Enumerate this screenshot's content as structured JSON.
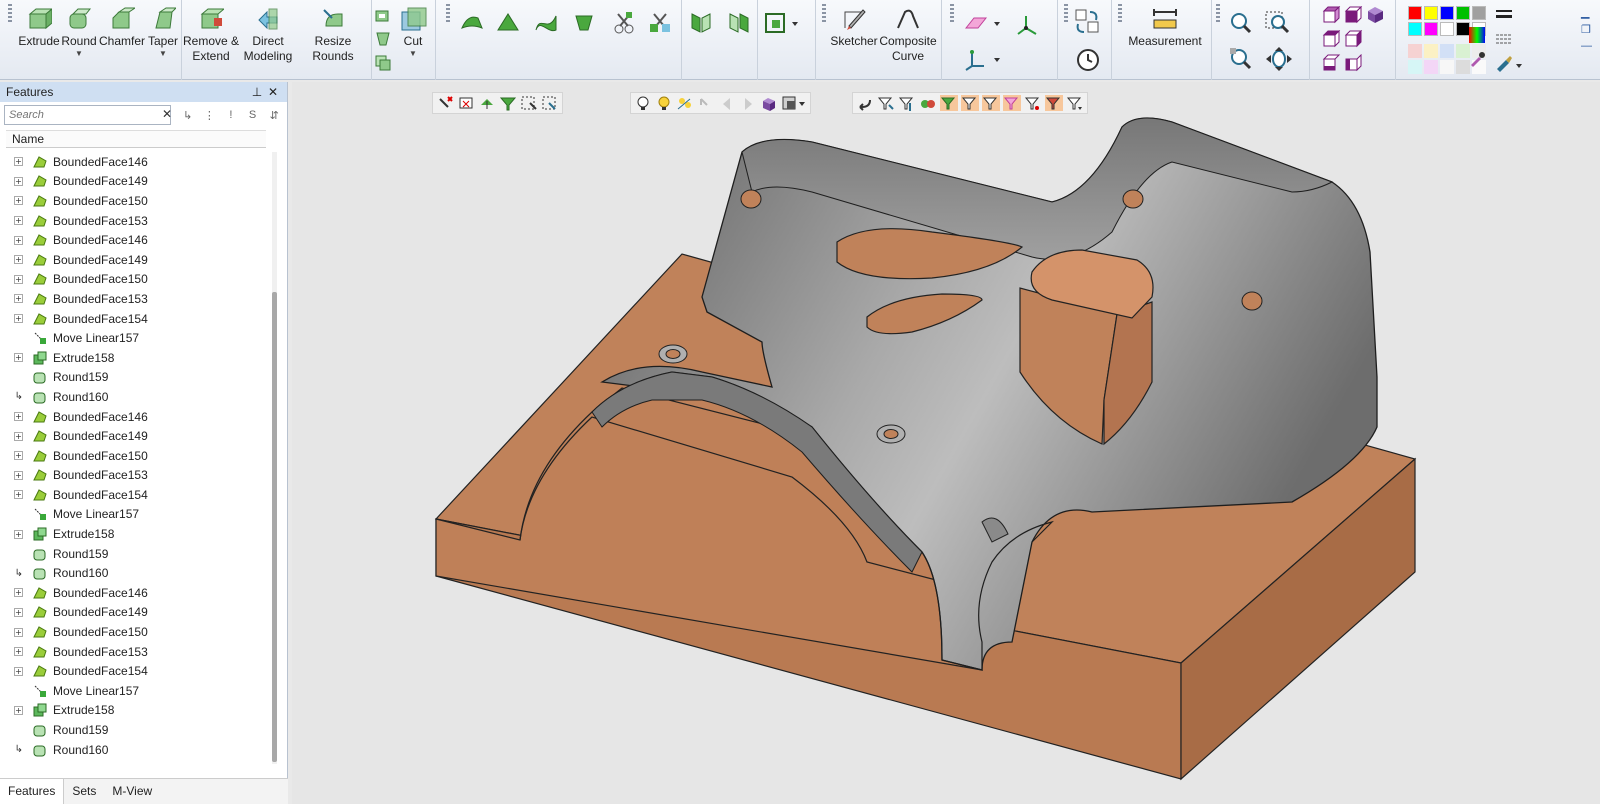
{
  "ribbon": {
    "extrude": "Extrude",
    "round": "Round",
    "chamfer": "Chamfer",
    "taper": "Taper",
    "remove_extend": [
      "Remove &",
      "Extend"
    ],
    "direct_modeling": [
      "Direct",
      "Modeling"
    ],
    "resize_rounds": "Resize Rounds",
    "cut": "Cut",
    "sketcher": "Sketcher",
    "composite_curve": [
      "Composite",
      "Curve"
    ],
    "measurement": "Measurement",
    "palette": [
      "#ff0000",
      "#ffff00",
      "#0000ff",
      "#00c000",
      "#a0a0a0",
      "#00ffff",
      "#ff00ff",
      "#ffffff",
      "#000000",
      "#ffffff"
    ]
  },
  "panel": {
    "title": "Features",
    "search_placeholder": "Search",
    "column": "Name",
    "tree": [
      {
        "label": "BoundedFace146",
        "kind": "face"
      },
      {
        "label": "BoundedFace149",
        "kind": "face"
      },
      {
        "label": "BoundedFace150",
        "kind": "face"
      },
      {
        "label": "BoundedFace153",
        "kind": "face"
      },
      {
        "label": "BoundedFace146",
        "kind": "face"
      },
      {
        "label": "BoundedFace149",
        "kind": "face"
      },
      {
        "label": "BoundedFace150",
        "kind": "face"
      },
      {
        "label": "BoundedFace153",
        "kind": "face"
      },
      {
        "label": "BoundedFace154",
        "kind": "face"
      },
      {
        "label": "Move Linear157",
        "kind": "move"
      },
      {
        "label": "Extrude158",
        "kind": "extrude"
      },
      {
        "label": "Round159",
        "kind": "round"
      },
      {
        "label": "Round160",
        "kind": "round2"
      },
      {
        "label": "BoundedFace146",
        "kind": "face"
      },
      {
        "label": "BoundedFace149",
        "kind": "face"
      },
      {
        "label": "BoundedFace150",
        "kind": "face"
      },
      {
        "label": "BoundedFace153",
        "kind": "face"
      },
      {
        "label": "BoundedFace154",
        "kind": "face"
      },
      {
        "label": "Move Linear157",
        "kind": "move"
      },
      {
        "label": "Extrude158",
        "kind": "extrude"
      },
      {
        "label": "Round159",
        "kind": "round"
      },
      {
        "label": "Round160",
        "kind": "round2"
      },
      {
        "label": "BoundedFace146",
        "kind": "face"
      },
      {
        "label": "BoundedFace149",
        "kind": "face"
      },
      {
        "label": "BoundedFace150",
        "kind": "face"
      },
      {
        "label": "BoundedFace153",
        "kind": "face"
      },
      {
        "label": "BoundedFace154",
        "kind": "face"
      },
      {
        "label": "Move Linear157",
        "kind": "move"
      },
      {
        "label": "Extrude158",
        "kind": "extrude"
      },
      {
        "label": "Round159",
        "kind": "round"
      },
      {
        "label": "Round160",
        "kind": "round2"
      }
    ],
    "tabs": [
      "Features",
      "Sets",
      "M-View"
    ]
  },
  "colors": {
    "copper": "#c0825a",
    "gray_body": "#8e8e8e",
    "viewport_bg": "#e6e6e6"
  }
}
